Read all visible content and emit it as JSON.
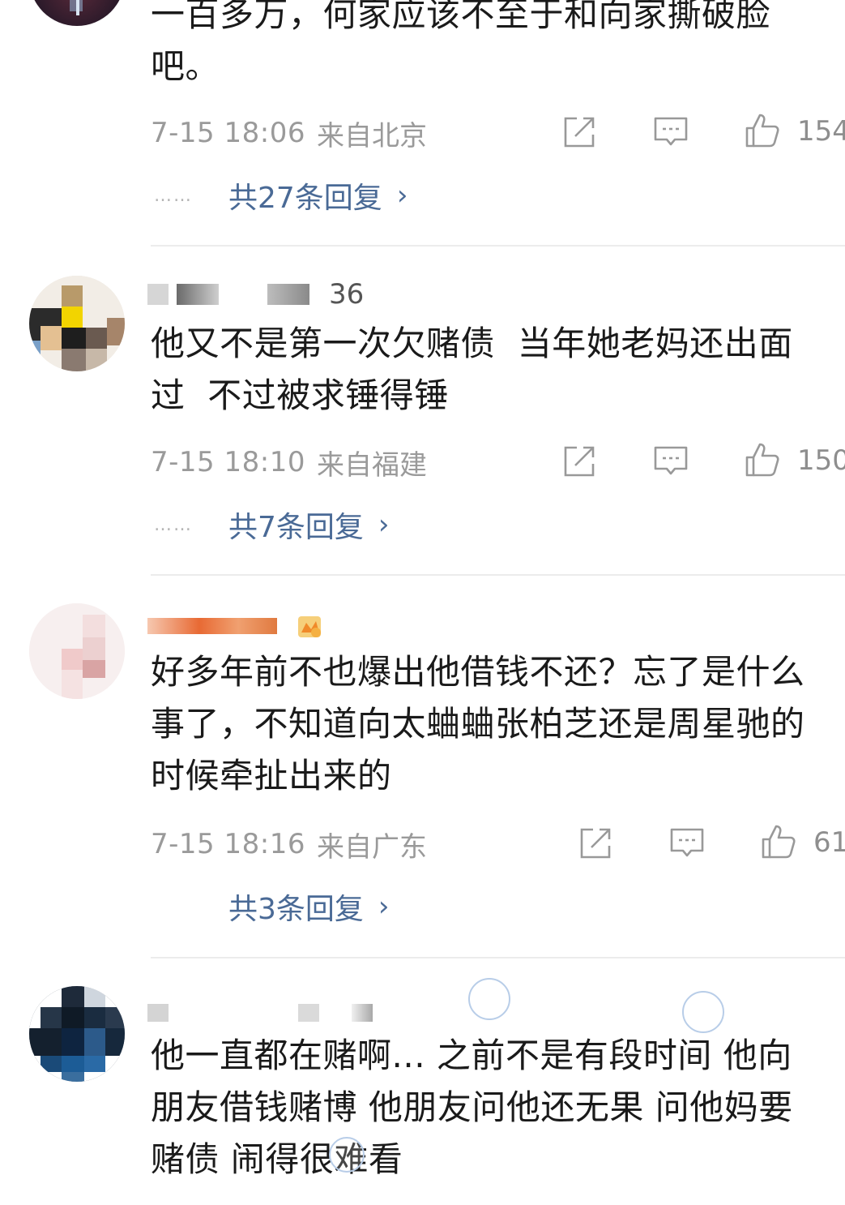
{
  "comments": [
    {
      "text": "一百多万，何家应该不至于和向家撕破脸\n吧。",
      "time": "7-15 18:06",
      "source": "来自北京",
      "likes": "154",
      "replies_label": "共27条回复",
      "replies_dots": "……"
    },
    {
      "username_visible": "36",
      "text": "他又不是第一次欠赌债  当年她老妈还出面\n过  不过被求锤得锤",
      "time": "7-15 18:10",
      "source": "来自福建",
      "likes": "150",
      "replies_label": "共7条回复",
      "replies_dots": "……"
    },
    {
      "text": "好多年前不也爆出他借钱不还？忘了是什么\n事了，不知道向太蛐蛐张柏芝还是周星驰的\n时候牵扯出来的",
      "time": "7-15 18:16",
      "source": "来自广东",
      "likes": "61",
      "replies_label": "共3条回复"
    },
    {
      "text": "他一直都在赌啊... 之前不是有段时间 他向\n朋友借钱赌博 他朋友问他还无果 问他妈要\n赌债 闹得很难看"
    }
  ],
  "icons": {
    "share": "share-icon",
    "comment": "comment-icon",
    "like": "thumbs-up-icon",
    "chevron": "chevron-right-icon"
  },
  "chevron_glyph": "›",
  "colors": {
    "reply_link": "#4a6a96",
    "meta": "#9a9a9a",
    "divider": "#ececec"
  }
}
